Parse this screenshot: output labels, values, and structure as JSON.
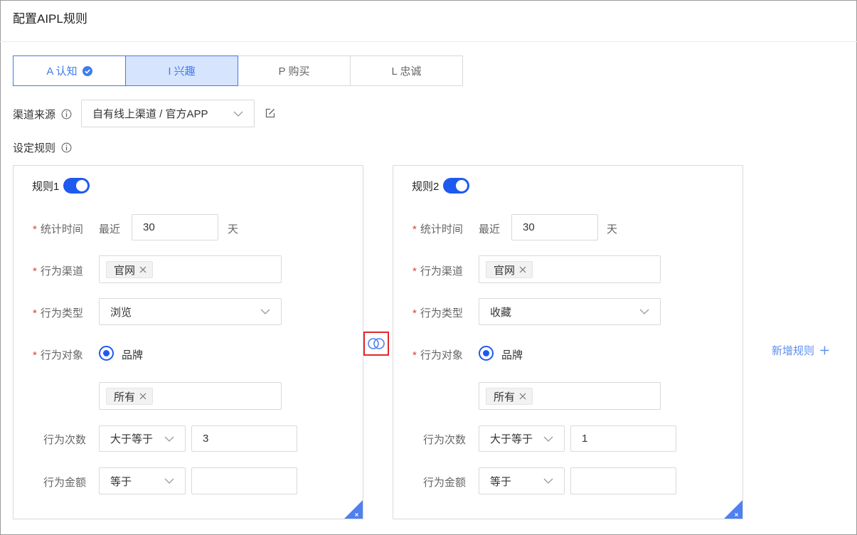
{
  "page": {
    "title": "配置AIPL规则"
  },
  "tabs": [
    {
      "label": "A 认知",
      "state": "done"
    },
    {
      "label": "I 兴趣",
      "state": "active"
    },
    {
      "label": "P 购买",
      "state": "default"
    },
    {
      "label": "L 忠诚",
      "state": "default"
    }
  ],
  "channel": {
    "label": "渠道来源",
    "value": "自有线上渠道 / 官方APP"
  },
  "rules_section": {
    "label": "设定规则"
  },
  "field_labels": {
    "time": "统计时间",
    "channel": "行为渠道",
    "type": "行为类型",
    "object": "行为对象",
    "count": "行为次数",
    "amount": "行为金额",
    "recent": "最近",
    "day_unit": "天"
  },
  "rules": [
    {
      "name": "规则1",
      "enabled": true,
      "days": "30",
      "channel_tag": "官网",
      "behavior_type": "浏览",
      "object_option": "品牌",
      "object_tag": "所有",
      "count_op": "大于等于",
      "count_value": "3",
      "amount_op": "等于",
      "amount_value": ""
    },
    {
      "name": "规则2",
      "enabled": true,
      "days": "30",
      "channel_tag": "官网",
      "behavior_type": "收藏",
      "object_option": "品牌",
      "object_tag": "所有",
      "count_op": "大于等于",
      "count_value": "1",
      "amount_op": "等于",
      "amount_value": ""
    }
  ],
  "add_rule": {
    "label": "新增规则"
  },
  "colors": {
    "accent": "#1f5af0",
    "tab_active_bg": "#d6e4fd",
    "required": "#e23a3a",
    "highlight_box": "#e0282e"
  },
  "icons": [
    "check-circle-icon",
    "info-icon",
    "chevron-down-icon",
    "edit-icon",
    "close-icon",
    "intersect-icon",
    "plus-icon",
    "delete-corner-icon"
  ]
}
